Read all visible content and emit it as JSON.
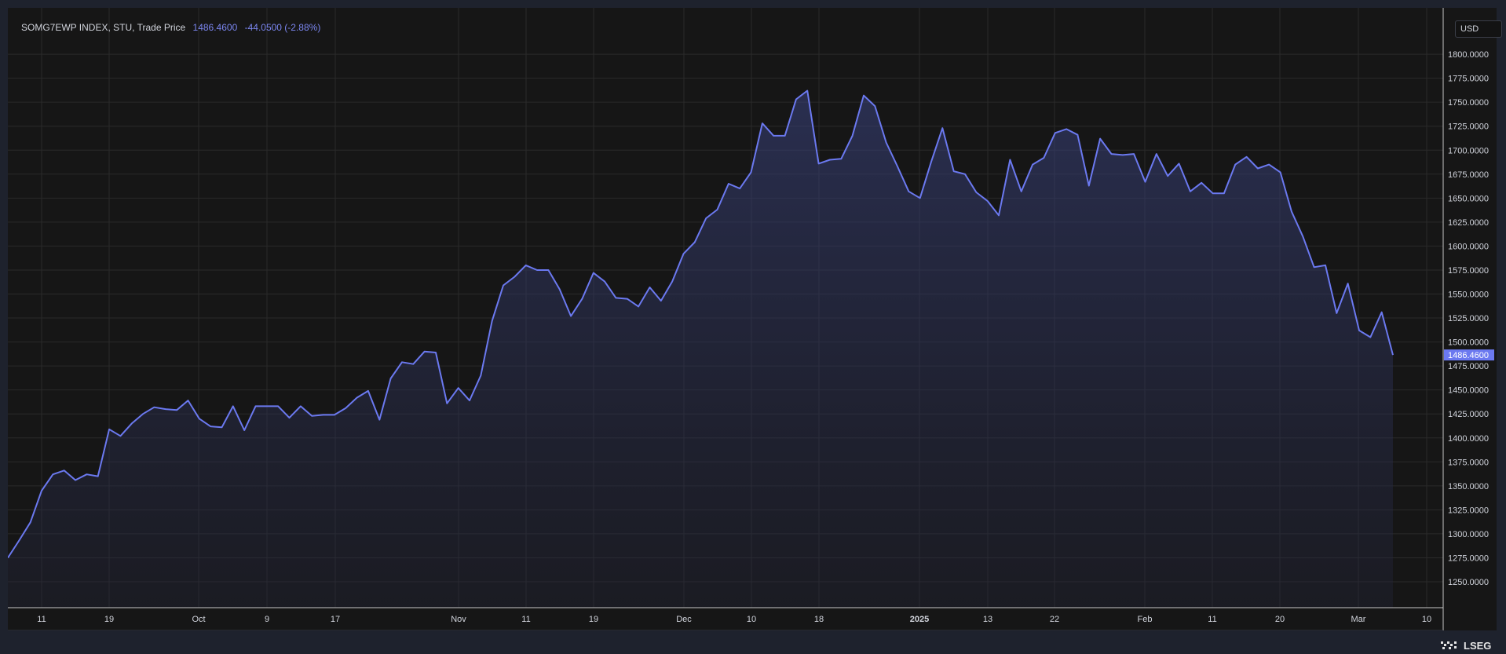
{
  "legend": {
    "symbol": "SOMG7EWP INDEX, STU, Trade Price",
    "last": "1486.4600",
    "change": "-44.0500 (-2.88%)"
  },
  "currency": "USD",
  "brand": "LSEG",
  "colors": {
    "line": "#6b79f0",
    "fill": "#2a2f5c",
    "background": "#161616",
    "grid": "#2a2a2a",
    "text": "#d1d4dc"
  },
  "chart_data": {
    "type": "area",
    "ylim": [
      1223,
      1832
    ],
    "y_ticks": [
      1250,
      1275,
      1300,
      1325,
      1350,
      1375,
      1400,
      1425,
      1450,
      1475,
      1500,
      1525,
      1550,
      1575,
      1600,
      1625,
      1650,
      1675,
      1700,
      1725,
      1750,
      1775,
      1800
    ],
    "x_tick_labels": [
      "11",
      "19",
      "Oct",
      "9",
      "17",
      "Nov",
      "11",
      "19",
      "Dec",
      "10",
      "18",
      "2025",
      "13",
      "22",
      "Feb",
      "11",
      "20",
      "Mar",
      "10"
    ],
    "last_value": 1486.46,
    "grid": true,
    "values": [
      1275,
      1293,
      1312,
      1345,
      1362,
      1366,
      1356,
      1362,
      1360,
      1409,
      1402,
      1415,
      1425,
      1432,
      1430,
      1429,
      1439,
      1420,
      1412,
      1411,
      1433,
      1408,
      1433,
      1433,
      1433,
      1421,
      1433,
      1423,
      1424,
      1424,
      1431,
      1442,
      1449,
      1419,
      1462,
      1479,
      1477,
      1490,
      1489,
      1436,
      1452,
      1439,
      1465,
      1522,
      1559,
      1568,
      1580,
      1575,
      1575,
      1555,
      1527,
      1545,
      1572,
      1563,
      1546,
      1545,
      1537,
      1557,
      1543,
      1563,
      1592,
      1604,
      1629,
      1638,
      1665,
      1660,
      1677,
      1728,
      1715,
      1715,
      1753,
      1762,
      1686,
      1690,
      1691,
      1715,
      1757,
      1746,
      1708,
      1683,
      1657,
      1650,
      1688,
      1723,
      1678,
      1675,
      1656,
      1647,
      1632,
      1690,
      1657,
      1685,
      1692,
      1718,
      1722,
      1716,
      1663,
      1712,
      1696,
      1695,
      1696,
      1667,
      1696,
      1673,
      1686,
      1657,
      1666,
      1655,
      1655,
      1685,
      1693,
      1681,
      1685,
      1677,
      1636,
      1610,
      1578,
      1580,
      1530,
      1561,
      1512,
      1505,
      1531,
      1486.46
    ]
  }
}
